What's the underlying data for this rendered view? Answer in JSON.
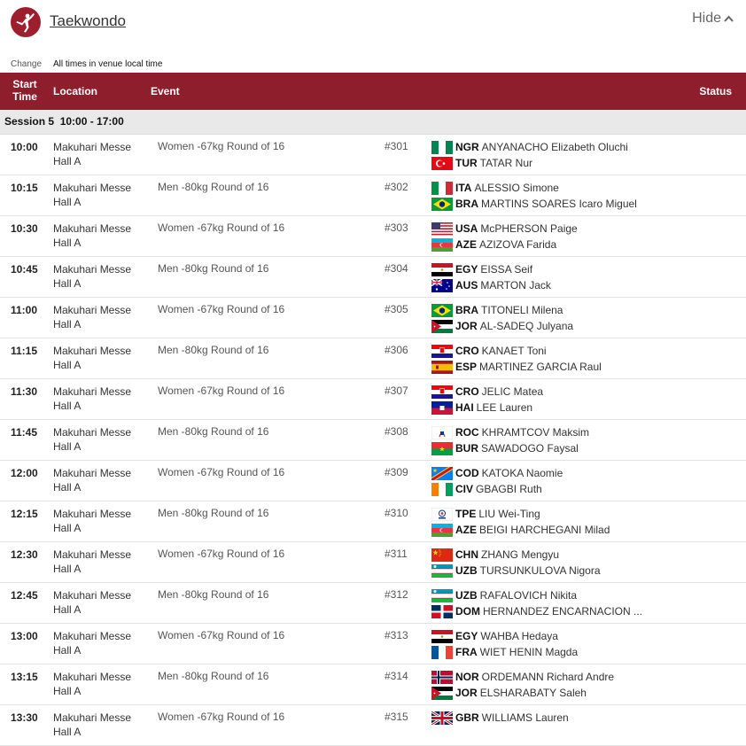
{
  "header": {
    "sport_title": "Taekwondo",
    "hide_label": "Hide",
    "logo_icon": "taekwondo-pictogram-icon",
    "brand_color": "#8f1e2c"
  },
  "timezone": {
    "change_label": "Change",
    "note": "All times in venue local time"
  },
  "table_header": {
    "start_time_line1": "Start",
    "start_time_line2": "Time",
    "location": "Location",
    "event": "Event",
    "status": "Status"
  },
  "session": {
    "label": "Session 5",
    "time_range": "10:00 - 17:00"
  },
  "rows": [
    {
      "time": "10:00",
      "loc1": "Makuhari Messe",
      "loc2": "Hall A",
      "event": "Women -67kg Round of 16",
      "num": "#301",
      "players": [
        {
          "flag": "NGR",
          "noc": "NGR",
          "name": "ANYANACHO Elizabeth Oluchi"
        },
        {
          "flag": "TUR",
          "noc": "TUR",
          "name": "TATAR Nur"
        }
      ]
    },
    {
      "time": "10:15",
      "loc1": "Makuhari Messe",
      "loc2": "Hall A",
      "event": "Men -80kg Round of 16",
      "num": "#302",
      "players": [
        {
          "flag": "ITA",
          "noc": "ITA",
          "name": "ALESSIO Simone"
        },
        {
          "flag": "BRA",
          "noc": "BRA",
          "name": "MARTINS SOARES Icaro Miguel"
        }
      ]
    },
    {
      "time": "10:30",
      "loc1": "Makuhari Messe",
      "loc2": "Hall A",
      "event": "Women -67kg Round of 16",
      "num": "#303",
      "players": [
        {
          "flag": "USA",
          "noc": "USA",
          "name": "McPHERSON Paige"
        },
        {
          "flag": "AZE",
          "noc": "AZE",
          "name": "AZIZOVA Farida"
        }
      ]
    },
    {
      "time": "10:45",
      "loc1": "Makuhari Messe",
      "loc2": "Hall A",
      "event": "Men -80kg Round of 16",
      "num": "#304",
      "players": [
        {
          "flag": "EGY",
          "noc": "EGY",
          "name": "EISSA Seif"
        },
        {
          "flag": "AUS",
          "noc": "AUS",
          "name": "MARTON Jack"
        }
      ]
    },
    {
      "time": "11:00",
      "loc1": "Makuhari Messe",
      "loc2": "Hall A",
      "event": "Women -67kg Round of 16",
      "num": "#305",
      "players": [
        {
          "flag": "BRA",
          "noc": "BRA",
          "name": "TITONELI Milena"
        },
        {
          "flag": "JOR",
          "noc": "JOR",
          "name": "AL-SADEQ Julyana"
        }
      ]
    },
    {
      "time": "11:15",
      "loc1": "Makuhari Messe",
      "loc2": "Hall A",
      "event": "Men -80kg Round of 16",
      "num": "#306",
      "players": [
        {
          "flag": "CRO",
          "noc": "CRO",
          "name": "KANAET Toni"
        },
        {
          "flag": "ESP",
          "noc": "ESP",
          "name": "MARTINEZ GARCIA Raul"
        }
      ]
    },
    {
      "time": "11:30",
      "loc1": "Makuhari Messe",
      "loc2": "Hall A",
      "event": "Women -67kg Round of 16",
      "num": "#307",
      "players": [
        {
          "flag": "CRO",
          "noc": "CRO",
          "name": "JELIC Matea"
        },
        {
          "flag": "HAI",
          "noc": "HAI",
          "name": "LEE Lauren"
        }
      ]
    },
    {
      "time": "11:45",
      "loc1": "Makuhari Messe",
      "loc2": "Hall A",
      "event": "Men -80kg Round of 16",
      "num": "#308",
      "players": [
        {
          "flag": "ROC",
          "noc": "ROC",
          "name": "KHRAMTCOV Maksim"
        },
        {
          "flag": "BUR",
          "noc": "BUR",
          "name": "SAWADOGO Faysal"
        }
      ]
    },
    {
      "time": "12:00",
      "loc1": "Makuhari Messe",
      "loc2": "Hall A",
      "event": "Women -67kg Round of 16",
      "num": "#309",
      "players": [
        {
          "flag": "COD",
          "noc": "COD",
          "name": "KATOKA Naomie"
        },
        {
          "flag": "CIV",
          "noc": "CIV",
          "name": "GBAGBI Ruth"
        }
      ]
    },
    {
      "time": "12:15",
      "loc1": "Makuhari Messe",
      "loc2": "Hall A",
      "event": "Men -80kg Round of 16",
      "num": "#310",
      "players": [
        {
          "flag": "TPE",
          "noc": "TPE",
          "name": "LIU Wei-Ting"
        },
        {
          "flag": "AZE",
          "noc": "AZE",
          "name": "BEIGI HARCHEGANI Milad"
        }
      ]
    },
    {
      "time": "12:30",
      "loc1": "Makuhari Messe",
      "loc2": "Hall A",
      "event": "Women -67kg Round of 16",
      "num": "#311",
      "players": [
        {
          "flag": "CHN",
          "noc": "CHN",
          "name": "ZHANG Mengyu"
        },
        {
          "flag": "UZB",
          "noc": "UZB",
          "name": "TURSUNKULOVA Nigora"
        }
      ]
    },
    {
      "time": "12:45",
      "loc1": "Makuhari Messe",
      "loc2": "Hall A",
      "event": "Men -80kg Round of 16",
      "num": "#312",
      "players": [
        {
          "flag": "UZB",
          "noc": "UZB",
          "name": "RAFALOVICH Nikita"
        },
        {
          "flag": "DOM",
          "noc": "DOM",
          "name": "HERNANDEZ ENCARNACION ..."
        }
      ]
    },
    {
      "time": "13:00",
      "loc1": "Makuhari Messe",
      "loc2": "Hall A",
      "event": "Women -67kg Round of 16",
      "num": "#313",
      "players": [
        {
          "flag": "EGY",
          "noc": "EGY",
          "name": "WAHBA Hedaya"
        },
        {
          "flag": "FRA",
          "noc": "FRA",
          "name": "WIET HENIN Magda"
        }
      ]
    },
    {
      "time": "13:15",
      "loc1": "Makuhari Messe",
      "loc2": "Hall A",
      "event": "Men -80kg Round of 16",
      "num": "#314",
      "players": [
        {
          "flag": "NOR",
          "noc": "NOR",
          "name": "ORDEMANN Richard Andre"
        },
        {
          "flag": "JOR",
          "noc": "JOR",
          "name": "ELSHARABATY Saleh"
        }
      ]
    },
    {
      "time": "13:30",
      "loc1": "Makuhari Messe",
      "loc2": "Hall A",
      "event": "Women -67kg Round of 16",
      "num": "#315",
      "players": [
        {
          "flag": "GBR",
          "noc": "GBR",
          "name": "WILLIAMS Lauren"
        }
      ]
    }
  ]
}
